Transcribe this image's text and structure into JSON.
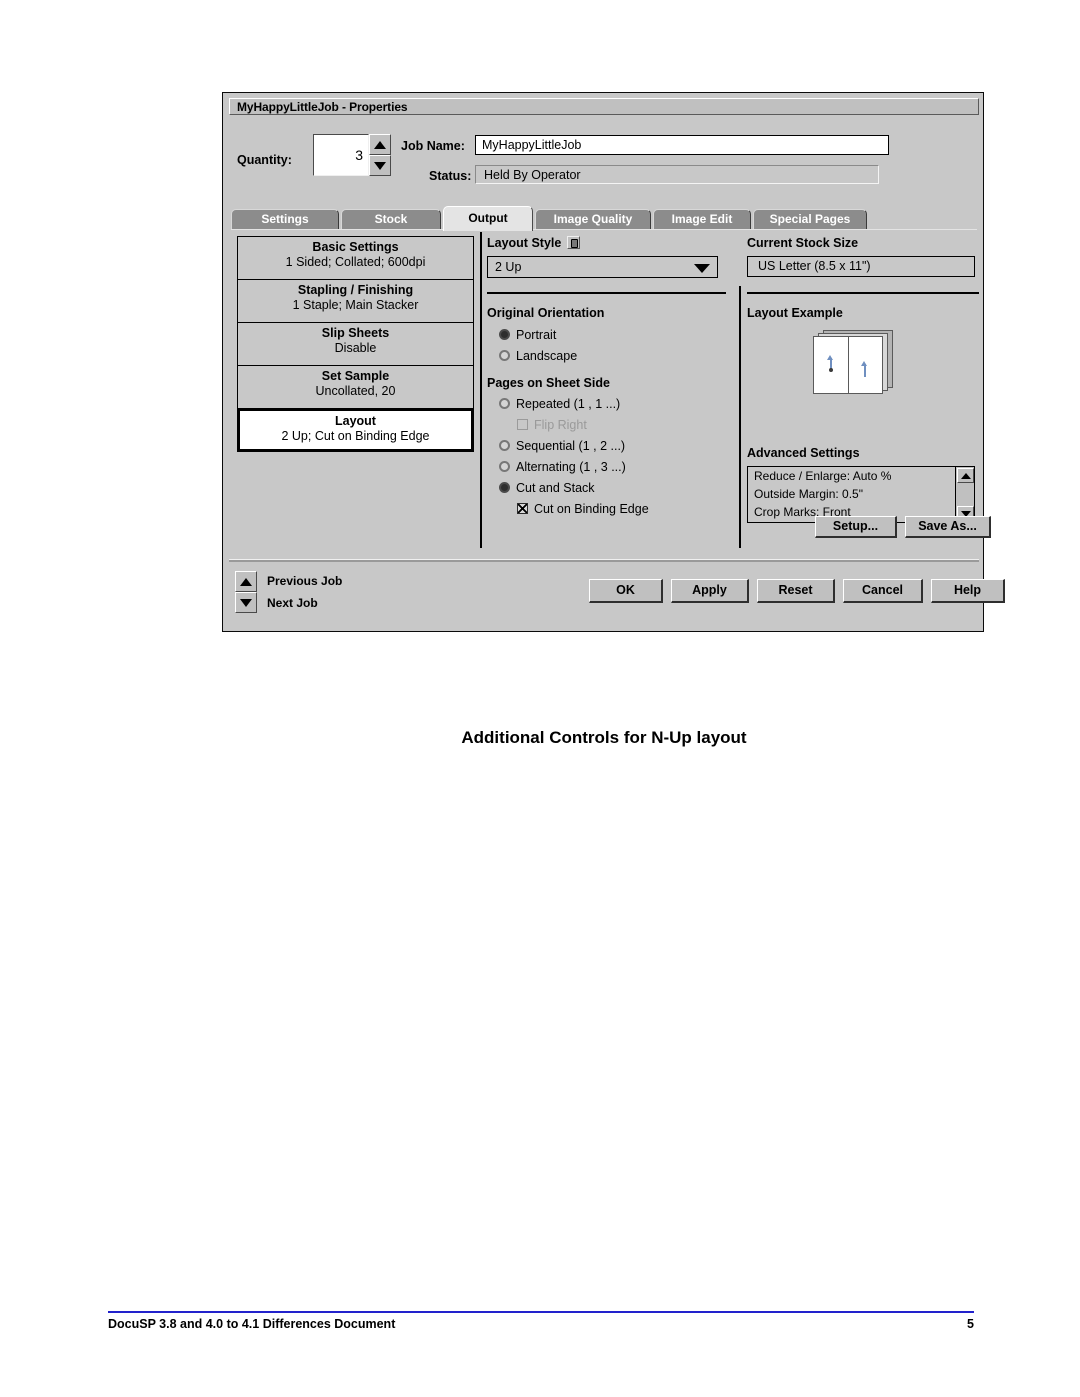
{
  "dialog": {
    "title": "MyHappyLittleJob - Properties",
    "header": {
      "quantity_label": "Quantity:",
      "quantity_value": "3",
      "spinner_up_icon": "triangle-up-icon",
      "spinner_down_icon": "triangle-down-icon",
      "job_name_label": "Job Name:",
      "job_name_value": "MyHappyLittleJob",
      "status_label": "Status:",
      "status_value": "Held By Operator"
    },
    "tabs": [
      {
        "label": "Settings",
        "active": false
      },
      {
        "label": "Stock",
        "active": false
      },
      {
        "label": "Output",
        "active": true
      },
      {
        "label": "Image Quality",
        "active": false
      },
      {
        "label": "Image Edit",
        "active": false
      },
      {
        "label": "Special Pages",
        "active": false
      }
    ],
    "summary": [
      {
        "title": "Basic Settings",
        "value": "1 Sided; Collated; 600dpi",
        "selected": false
      },
      {
        "title": "Stapling / Finishing",
        "value": "1 Staple; Main Stacker",
        "selected": false
      },
      {
        "title": "Slip Sheets",
        "value": "Disable",
        "selected": false
      },
      {
        "title": "Set Sample",
        "value": "Uncollated, 20",
        "selected": false
      },
      {
        "title": "Layout",
        "value": "2 Up; Cut on Binding Edge",
        "selected": true
      }
    ],
    "layout_style": {
      "label": "Layout Style",
      "lock_icon": "lock-icon",
      "value": "2 Up",
      "dropdown_icon": "chevron-down-icon"
    },
    "original_orientation": {
      "label": "Original Orientation",
      "options": [
        {
          "label": "Portrait",
          "selected": true
        },
        {
          "label": "Landscape",
          "selected": false
        }
      ]
    },
    "pages_on_sheet_side": {
      "label": "Pages on Sheet Side",
      "options": [
        {
          "label": "Repeated (1 , 1 ...)",
          "selected": false
        },
        {
          "label": "Sequential (1 , 2 ...)",
          "selected": false
        },
        {
          "label": "Alternating (1 , 3 ...)",
          "selected": false
        },
        {
          "label": "Cut and Stack",
          "selected": true
        }
      ],
      "flip_right": {
        "label": "Flip Right",
        "checked": false,
        "disabled": true
      },
      "cut_on_binding_edge": {
        "label": "Cut on Binding Edge",
        "checked": true,
        "disabled": false
      }
    },
    "current_stock_size": {
      "label": "Current Stock Size",
      "value": "US Letter (8.5 x 11\")"
    },
    "layout_example": {
      "label": "Layout Example",
      "art": "stacked-sheets-2up-illustration"
    },
    "advanced_settings": {
      "label": "Advanced Settings",
      "items": [
        "Reduce / Enlarge: Auto %",
        "Outside Margin: 0.5\"",
        "Crop Marks: Front"
      ],
      "scroll_up_icon": "triangle-up-icon",
      "scroll_down_icon": "triangle-down-icon"
    },
    "panel_buttons": [
      {
        "label": "Setup..."
      },
      {
        "label": "Save As..."
      }
    ],
    "job_nav": {
      "previous_label": "Previous Job",
      "next_label": "Next Job",
      "up_icon": "triangle-up-icon",
      "down_icon": "triangle-down-icon"
    },
    "action_buttons": [
      {
        "label": "OK"
      },
      {
        "label": "Apply"
      },
      {
        "label": "Reset"
      },
      {
        "label": "Cancel"
      },
      {
        "label": "Help"
      }
    ]
  },
  "caption": "Additional Controls for N-Up layout",
  "footer": {
    "text": "DocuSP 3.8 and 4.0 to 4.1 Differences Document",
    "page": "5",
    "rule_color": "#2222cc"
  }
}
